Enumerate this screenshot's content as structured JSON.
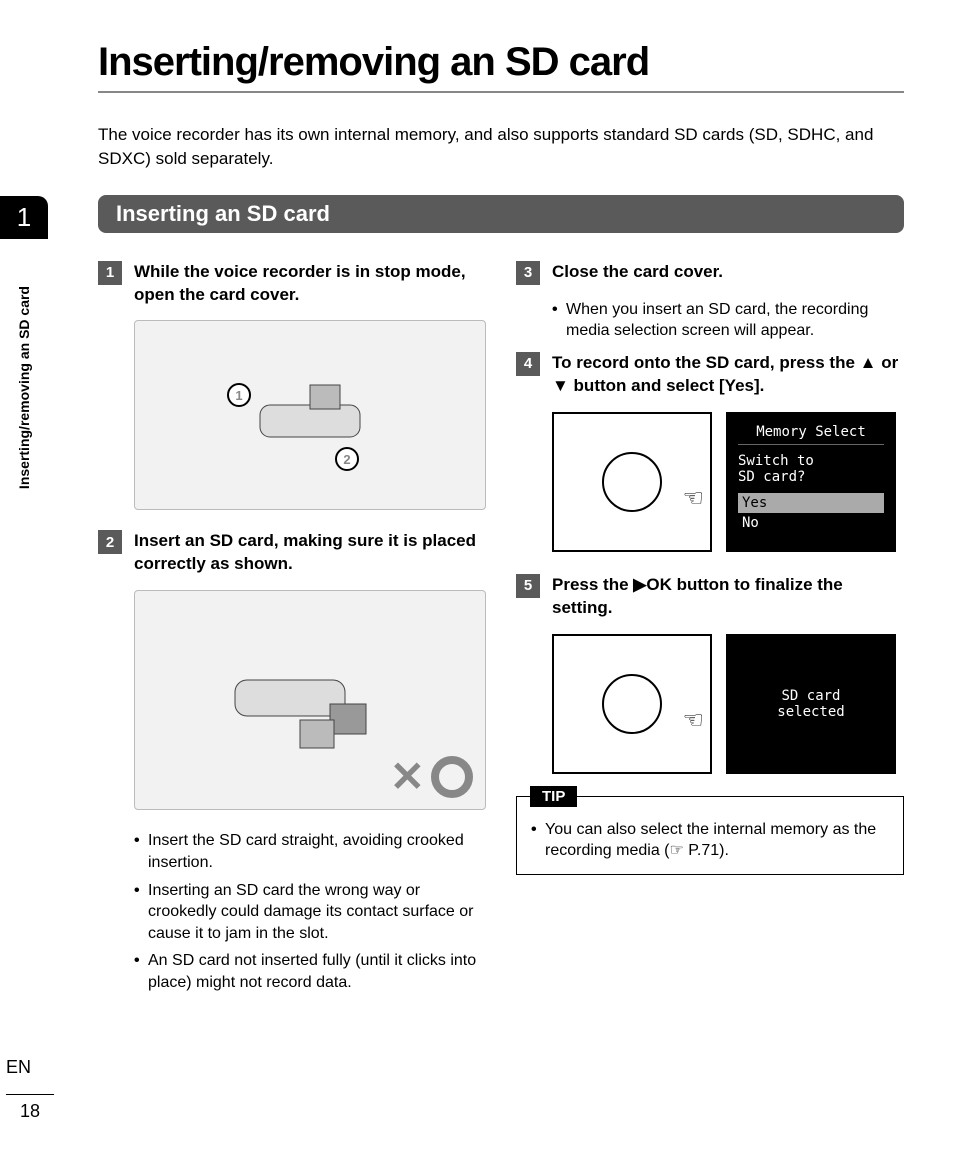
{
  "page": {
    "title": "Inserting/removing an SD card",
    "intro": "The voice recorder has its own internal memory, and also supports standard SD cards (SD, SDHC, and SDXC) sold separately.",
    "chapter_number": "1",
    "side_label": "Inserting/removing an SD card",
    "language": "EN",
    "page_number": "18"
  },
  "section": {
    "heading": "Inserting an SD card"
  },
  "steps": {
    "s1": {
      "num": "1",
      "text": "While the voice recorder is in stop mode, open the card cover.",
      "callouts": [
        "1",
        "2"
      ]
    },
    "s2": {
      "num": "2",
      "text": "Insert an SD card, making sure it is placed correctly as shown.",
      "bullets": [
        "Insert the SD card straight, avoiding crooked insertion.",
        "Inserting an SD card the wrong way or crookedly could damage its contact surface or cause it to jam in the slot.",
        "An SD card not inserted fully (until it clicks into place) might not record data."
      ]
    },
    "s3": {
      "num": "3",
      "text": "Close the card cover.",
      "bullets": [
        "When you insert an SD card, the recording media selection screen will appear."
      ]
    },
    "s4": {
      "num": "4",
      "text_parts": {
        "a": "To record onto the SD card, press the ",
        "b": " or ",
        "c": " button and select [",
        "d": "Yes",
        "e": "]."
      }
    },
    "s5": {
      "num": "5",
      "text_parts": {
        "a": "Press the ",
        "b": "OK",
        "c": " button to finalize the setting."
      }
    }
  },
  "lcd1": {
    "title": "Memory Select",
    "line1": "Switch to",
    "line2": "SD card?",
    "opt_yes": "Yes",
    "opt_no": "No"
  },
  "lcd2": {
    "line1": "SD card",
    "line2": "selected"
  },
  "tip": {
    "label": "TIP",
    "text_a": "You can also select the internal memory as the recording media (",
    "text_b": " P.71)."
  }
}
